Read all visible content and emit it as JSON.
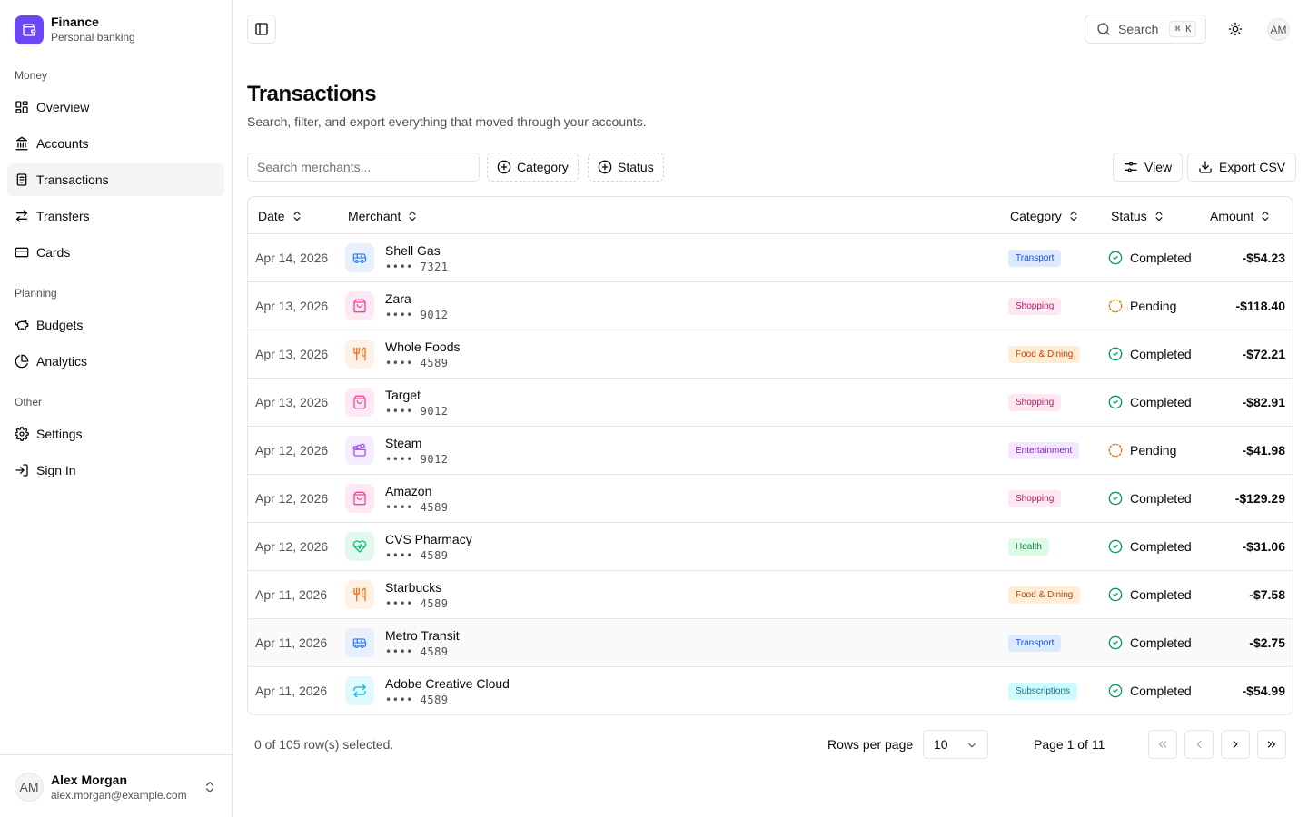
{
  "brand": {
    "name": "Finance",
    "subtitle": "Personal banking",
    "color": "#6b47f5"
  },
  "nav": {
    "groups": [
      {
        "label": "Money"
      },
      {
        "label": "Planning"
      },
      {
        "label": "Other"
      }
    ],
    "items": [
      {
        "label": "Overview",
        "icon": "layout-grid-icon"
      },
      {
        "label": "Accounts",
        "icon": "bank-icon"
      },
      {
        "label": "Transactions",
        "icon": "receipt-icon",
        "active": true
      },
      {
        "label": "Transfers",
        "icon": "arrows-right-left-icon"
      },
      {
        "label": "Cards",
        "icon": "credit-card-icon"
      },
      {
        "label": "Budgets",
        "icon": "piggy-bank-icon"
      },
      {
        "label": "Analytics",
        "icon": "pie-chart-icon"
      },
      {
        "label": "Settings",
        "icon": "gear-icon"
      },
      {
        "label": "Sign In",
        "icon": "log-in-icon"
      }
    ]
  },
  "user": {
    "initials": "AM",
    "name": "Alex Morgan",
    "email": "alex.morgan@example.com"
  },
  "header": {
    "search_label": "Search",
    "search_shortcut": "⌘ K",
    "avatar_initials": "AM"
  },
  "page": {
    "title": "Transactions",
    "subtitle": "Search, filter, and export everything that moved through your accounts."
  },
  "toolbar": {
    "search_placeholder": "Search merchants...",
    "category_label": "Category",
    "status_label": "Status",
    "view_label": "View",
    "export_label": "Export CSV"
  },
  "table": {
    "columns": {
      "date": "Date",
      "merchant": "Merchant",
      "category": "Category",
      "status": "Status",
      "amount": "Amount"
    },
    "rows": [
      {
        "date": "Apr 14, 2026",
        "merchant": "Shell Gas",
        "card": "•••• 7321",
        "category": "Transport",
        "status": "Completed",
        "amount": "-$54.23"
      },
      {
        "date": "Apr 13, 2026",
        "merchant": "Zara",
        "card": "•••• 9012",
        "category": "Shopping",
        "status": "Pending",
        "amount": "-$118.40"
      },
      {
        "date": "Apr 13, 2026",
        "merchant": "Whole Foods",
        "card": "•••• 4589",
        "category": "Food & Dining",
        "status": "Completed",
        "amount": "-$72.21"
      },
      {
        "date": "Apr 13, 2026",
        "merchant": "Target",
        "card": "•••• 9012",
        "category": "Shopping",
        "status": "Completed",
        "amount": "-$82.91"
      },
      {
        "date": "Apr 12, 2026",
        "merchant": "Steam",
        "card": "•••• 9012",
        "category": "Entertainment",
        "status": "Pending",
        "amount": "-$41.98"
      },
      {
        "date": "Apr 12, 2026",
        "merchant": "Amazon",
        "card": "•••• 4589",
        "category": "Shopping",
        "status": "Completed",
        "amount": "-$129.29"
      },
      {
        "date": "Apr 12, 2026",
        "merchant": "CVS Pharmacy",
        "card": "•••• 4589",
        "category": "Health",
        "status": "Completed",
        "amount": "-$31.06"
      },
      {
        "date": "Apr 11, 2026",
        "merchant": "Starbucks",
        "card": "•••• 4589",
        "category": "Food & Dining",
        "status": "Completed",
        "amount": "-$7.58"
      },
      {
        "date": "Apr 11, 2026",
        "merchant": "Metro Transit",
        "card": "•••• 4589",
        "category": "Transport",
        "status": "Completed",
        "amount": "-$2.75"
      },
      {
        "date": "Apr 11, 2026",
        "merchant": "Adobe Creative Cloud",
        "card": "•••• 4589",
        "category": "Subscriptions",
        "status": "Completed",
        "amount": "-$54.99"
      }
    ]
  },
  "category_styles": {
    "Transport": {
      "icon": "bus-icon",
      "bg": "#dbeafe",
      "fg": "#1d4ed8",
      "icon_bg": "#e8f0fe",
      "icon_fg": "#3b82f6"
    },
    "Shopping": {
      "icon": "shopping-bag-icon",
      "bg": "#fce7f3",
      "fg": "#be185d",
      "icon_bg": "#fde8f3",
      "icon_fg": "#ec4899"
    },
    "Food & Dining": {
      "icon": "utensils-icon",
      "bg": "#ffedd5",
      "fg": "#c2410c",
      "icon_bg": "#fff1e6",
      "icon_fg": "#f97316"
    },
    "Entertainment": {
      "icon": "clapperboard-icon",
      "bg": "#f3e8ff",
      "fg": "#7e22ce",
      "icon_bg": "#f5ecff",
      "icon_fg": "#a855f7"
    },
    "Health": {
      "icon": "heart-pulse-icon",
      "bg": "#dcfce7",
      "fg": "#15803d",
      "icon_bg": "#e3f8ec",
      "icon_fg": "#10b981"
    },
    "Subscriptions": {
      "icon": "repeat-icon",
      "bg": "#cffafe",
      "fg": "#0e7490",
      "icon_bg": "#e0f9fc",
      "icon_fg": "#06b6d4"
    }
  },
  "status_colors": {
    "Completed": "#059669",
    "Pending": "#d97706"
  },
  "pagination": {
    "selected_text": "0 of 105 row(s) selected.",
    "rows_per_page_label": "Rows per page",
    "rows_per_page_value": "10",
    "page_text": "Page 1 of 11"
  }
}
